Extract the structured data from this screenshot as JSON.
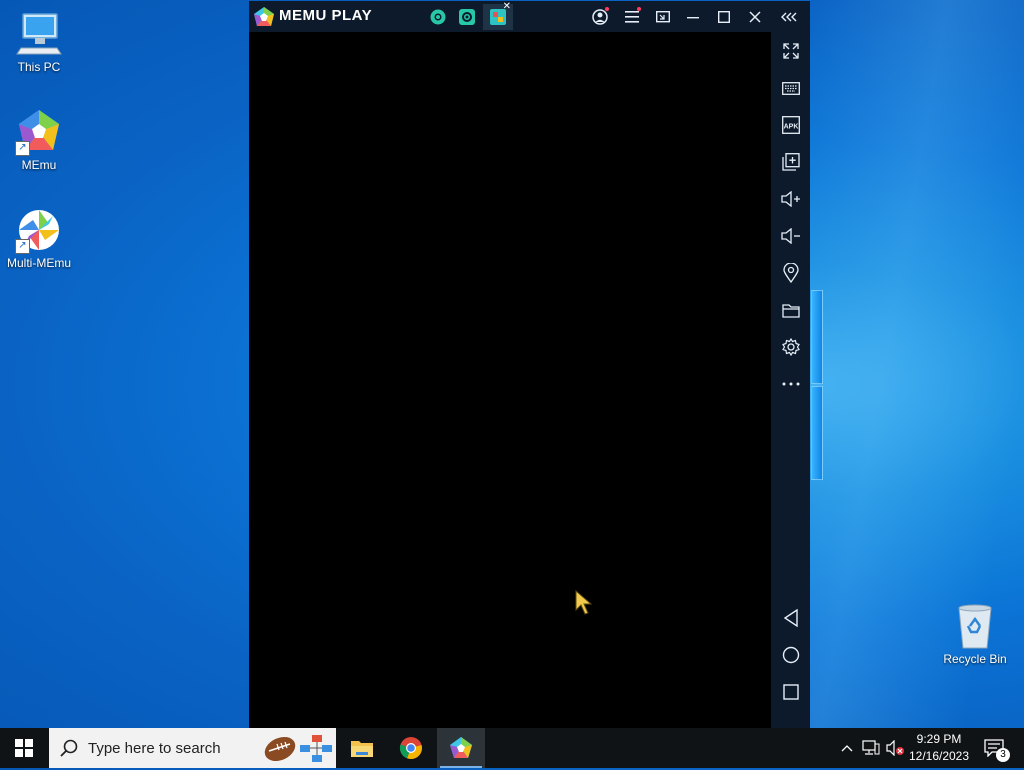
{
  "desktop": {
    "icons": [
      {
        "label": "This PC"
      },
      {
        "label": "MEmu"
      },
      {
        "label": "Multi-MEmu"
      },
      {
        "label": "Recycle Bin"
      }
    ]
  },
  "memu": {
    "brand": "MEMU PLAY",
    "titlebar_icons": [
      "home-tab-icon",
      "settings-tab-icon",
      "app-tab-icon",
      "account-icon",
      "menu-icon",
      "screen-mirror-icon",
      "minimize-icon",
      "maximize-icon",
      "close-icon",
      "collapse-sidebar-icon"
    ],
    "sidebar_icons": [
      "fullscreen-icon",
      "keyboard-icon",
      "apk-icon",
      "multi-window-icon",
      "volume-up-icon",
      "volume-down-icon",
      "location-icon",
      "folder-icon",
      "settings-icon",
      "more-icon",
      "back-icon",
      "home-icon",
      "recents-icon"
    ],
    "apk_label": "APK"
  },
  "taskbar": {
    "search_placeholder": "Type here to search",
    "apps": [
      "file-explorer",
      "chrome",
      "memu"
    ],
    "clock_time": "9:29 PM",
    "clock_date": "12/16/2023",
    "notification_count": "3"
  },
  "colors": {
    "memu_chrome": "#0d1a2b",
    "taskbar": "#101316",
    "desktop_blue": "#0b74d6"
  }
}
